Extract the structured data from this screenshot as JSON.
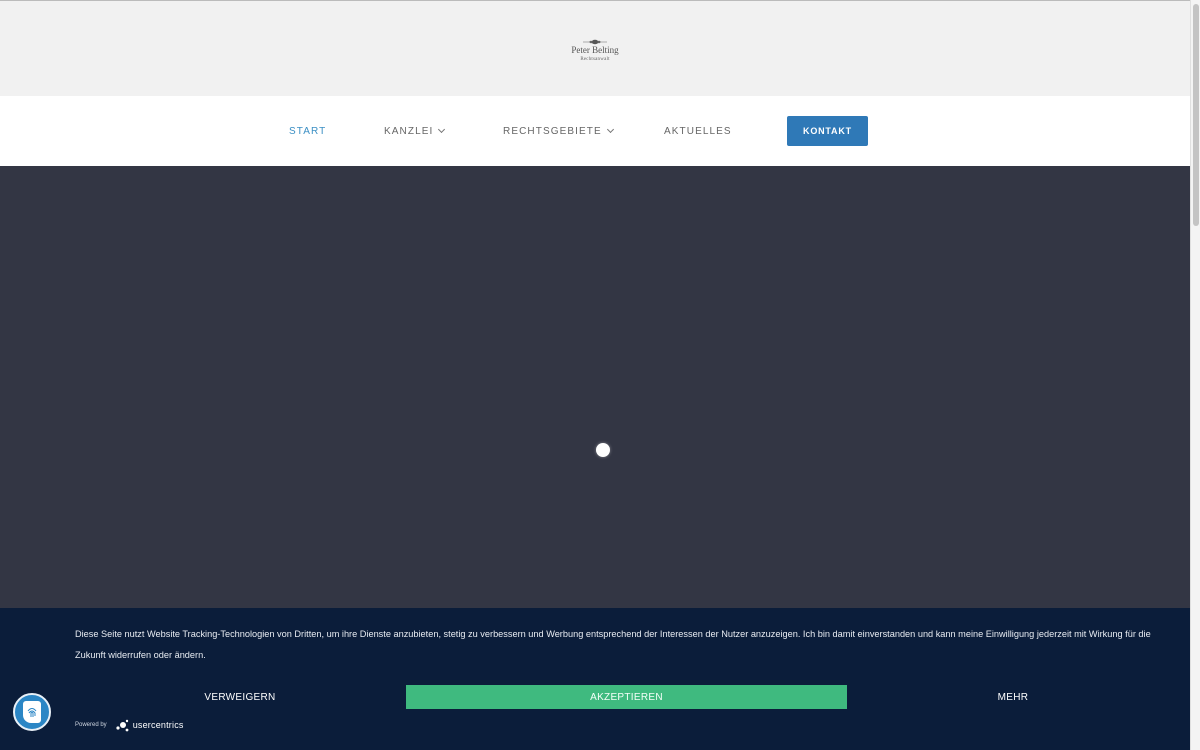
{
  "brand": {
    "name": "Peter Belting",
    "subtitle": "Rechtsanwalt"
  },
  "nav": {
    "items": [
      {
        "label": "START",
        "active": true
      },
      {
        "label": "KANZLEI",
        "dropdown": true
      },
      {
        "label": "RECHTSGEBIETE",
        "dropdown": true
      },
      {
        "label": "AKTUELLES"
      }
    ],
    "cta": "KONTAKT"
  },
  "consent": {
    "text": "Diese Seite nutzt Website Tracking-Technologien von Dritten, um ihre Dienste anzubieten, stetig zu verbessern und Werbung entsprechend der Interessen der Nutzer anzuzeigen. Ich bin damit einverstanden und kann meine Einwilligung jederzeit mit Wirkung für die Zukunft widerrufen oder ändern.",
    "refuse_label": "VERWEIGERN",
    "accept_label": "AKZEPTIEREN",
    "more_label": "MEHR",
    "powered_by": "Powered by",
    "provider": "usercentrics"
  },
  "icons": {
    "privacy_button": "fingerprint-icon",
    "loader": "loading-dot-icon"
  },
  "colors": {
    "accent": "#2f79b7",
    "active_nav": "#3b8fc4",
    "hero_bg": "#333644",
    "consent_bg": "#0b1d3a",
    "accept_bg": "#3fba7f"
  }
}
